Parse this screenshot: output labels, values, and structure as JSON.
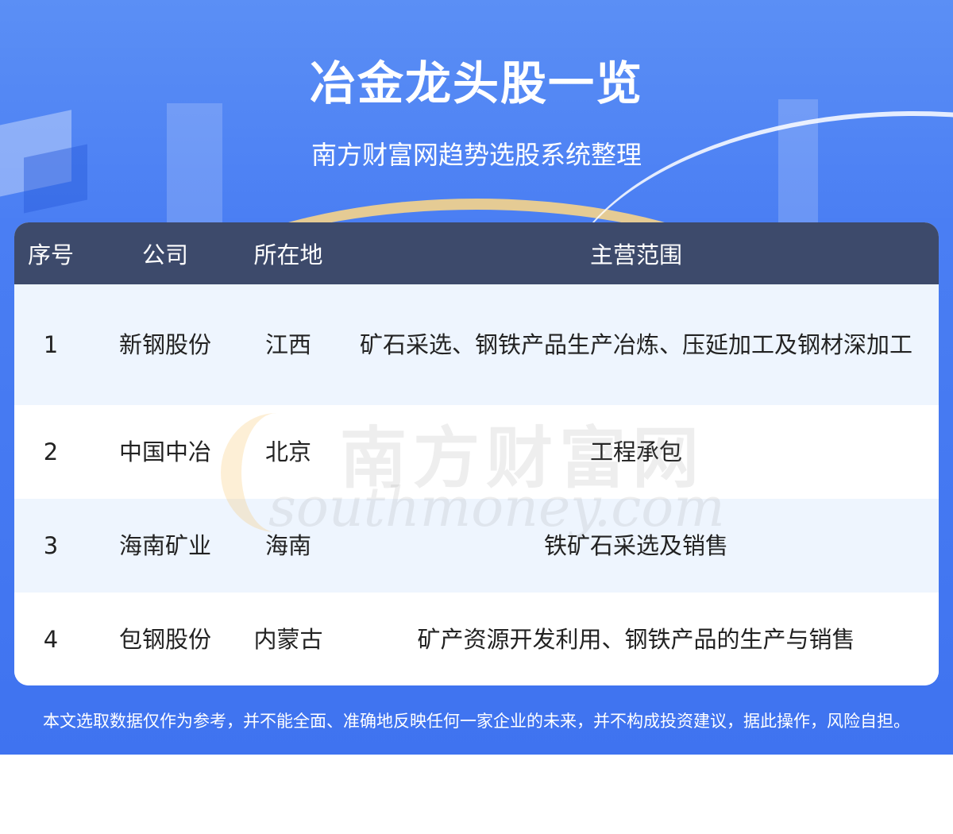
{
  "header": {
    "title": "冶金龙头股一览",
    "subtitle": "南方财富网趋势选股系统整理"
  },
  "table": {
    "columns": [
      "序号",
      "公司",
      "所在地",
      "主营范围"
    ],
    "rows": [
      {
        "index": "1",
        "company": "新钢股份",
        "location": "江西",
        "business": "矿石采选、钢铁产品生产冶炼、压延加工及钢材深加工"
      },
      {
        "index": "2",
        "company": "中国中冶",
        "location": "北京",
        "business": "工程承包"
      },
      {
        "index": "3",
        "company": "海南矿业",
        "location": "海南",
        "business": "铁矿石采选及销售"
      },
      {
        "index": "4",
        "company": "包钢股份",
        "location": "内蒙古",
        "business": "矿产资源开发利用、钢铁产品的生产与销售"
      }
    ]
  },
  "watermark": {
    "cn": "南方财富网",
    "en": "southmoney.com"
  },
  "footer": {
    "disclaimer": "本文选取数据仅作为参考，并不能全面、准确地反映任何一家企业的未来，并不构成投资建议，据此操作，风险自担。"
  },
  "colors": {
    "banner": "#4a7ef3",
    "table_header": "#3d4a6b",
    "row_alt": "#eef5fe",
    "accent_gold": "#f6d48a"
  }
}
